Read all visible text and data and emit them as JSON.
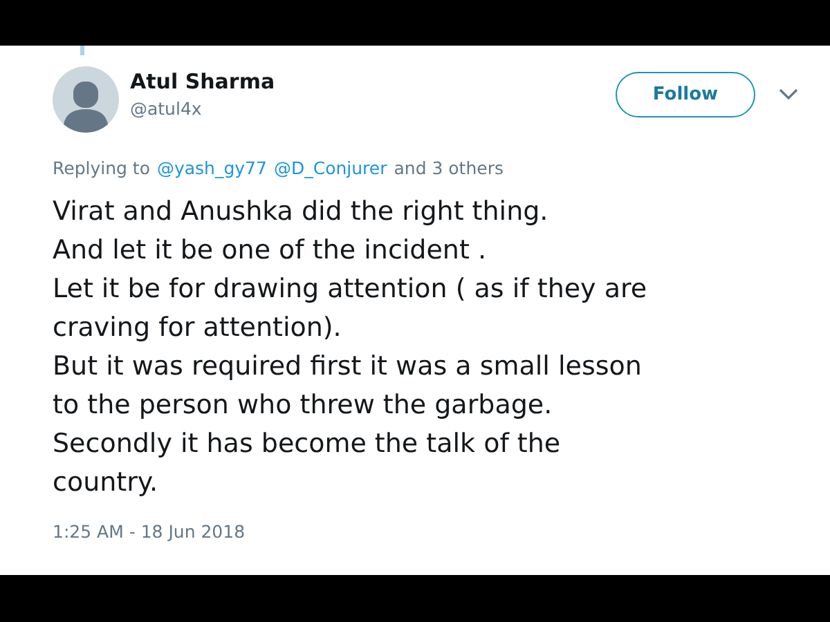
{
  "tweet": {
    "author": {
      "name": "Atul Sharma",
      "handle": "@atul4x"
    },
    "follow_button": "Follow",
    "replying": {
      "prefix": "Replying to",
      "mentions": [
        "@yash_gy77",
        "@D_Conjurer"
      ],
      "suffix": "and 3 others"
    },
    "text": "Virat and Anushka did the right thing.\nAnd let it be one of the incident .\nLet it be for drawing attention ( as if they are\ncraving for attention).\nBut it was required first it was a small lesson\nto the person who threw the garbage.\nSecondly it has become the talk of the\ncountry.",
    "timestamp": "1:25 AM - 18 Jun 2018"
  }
}
